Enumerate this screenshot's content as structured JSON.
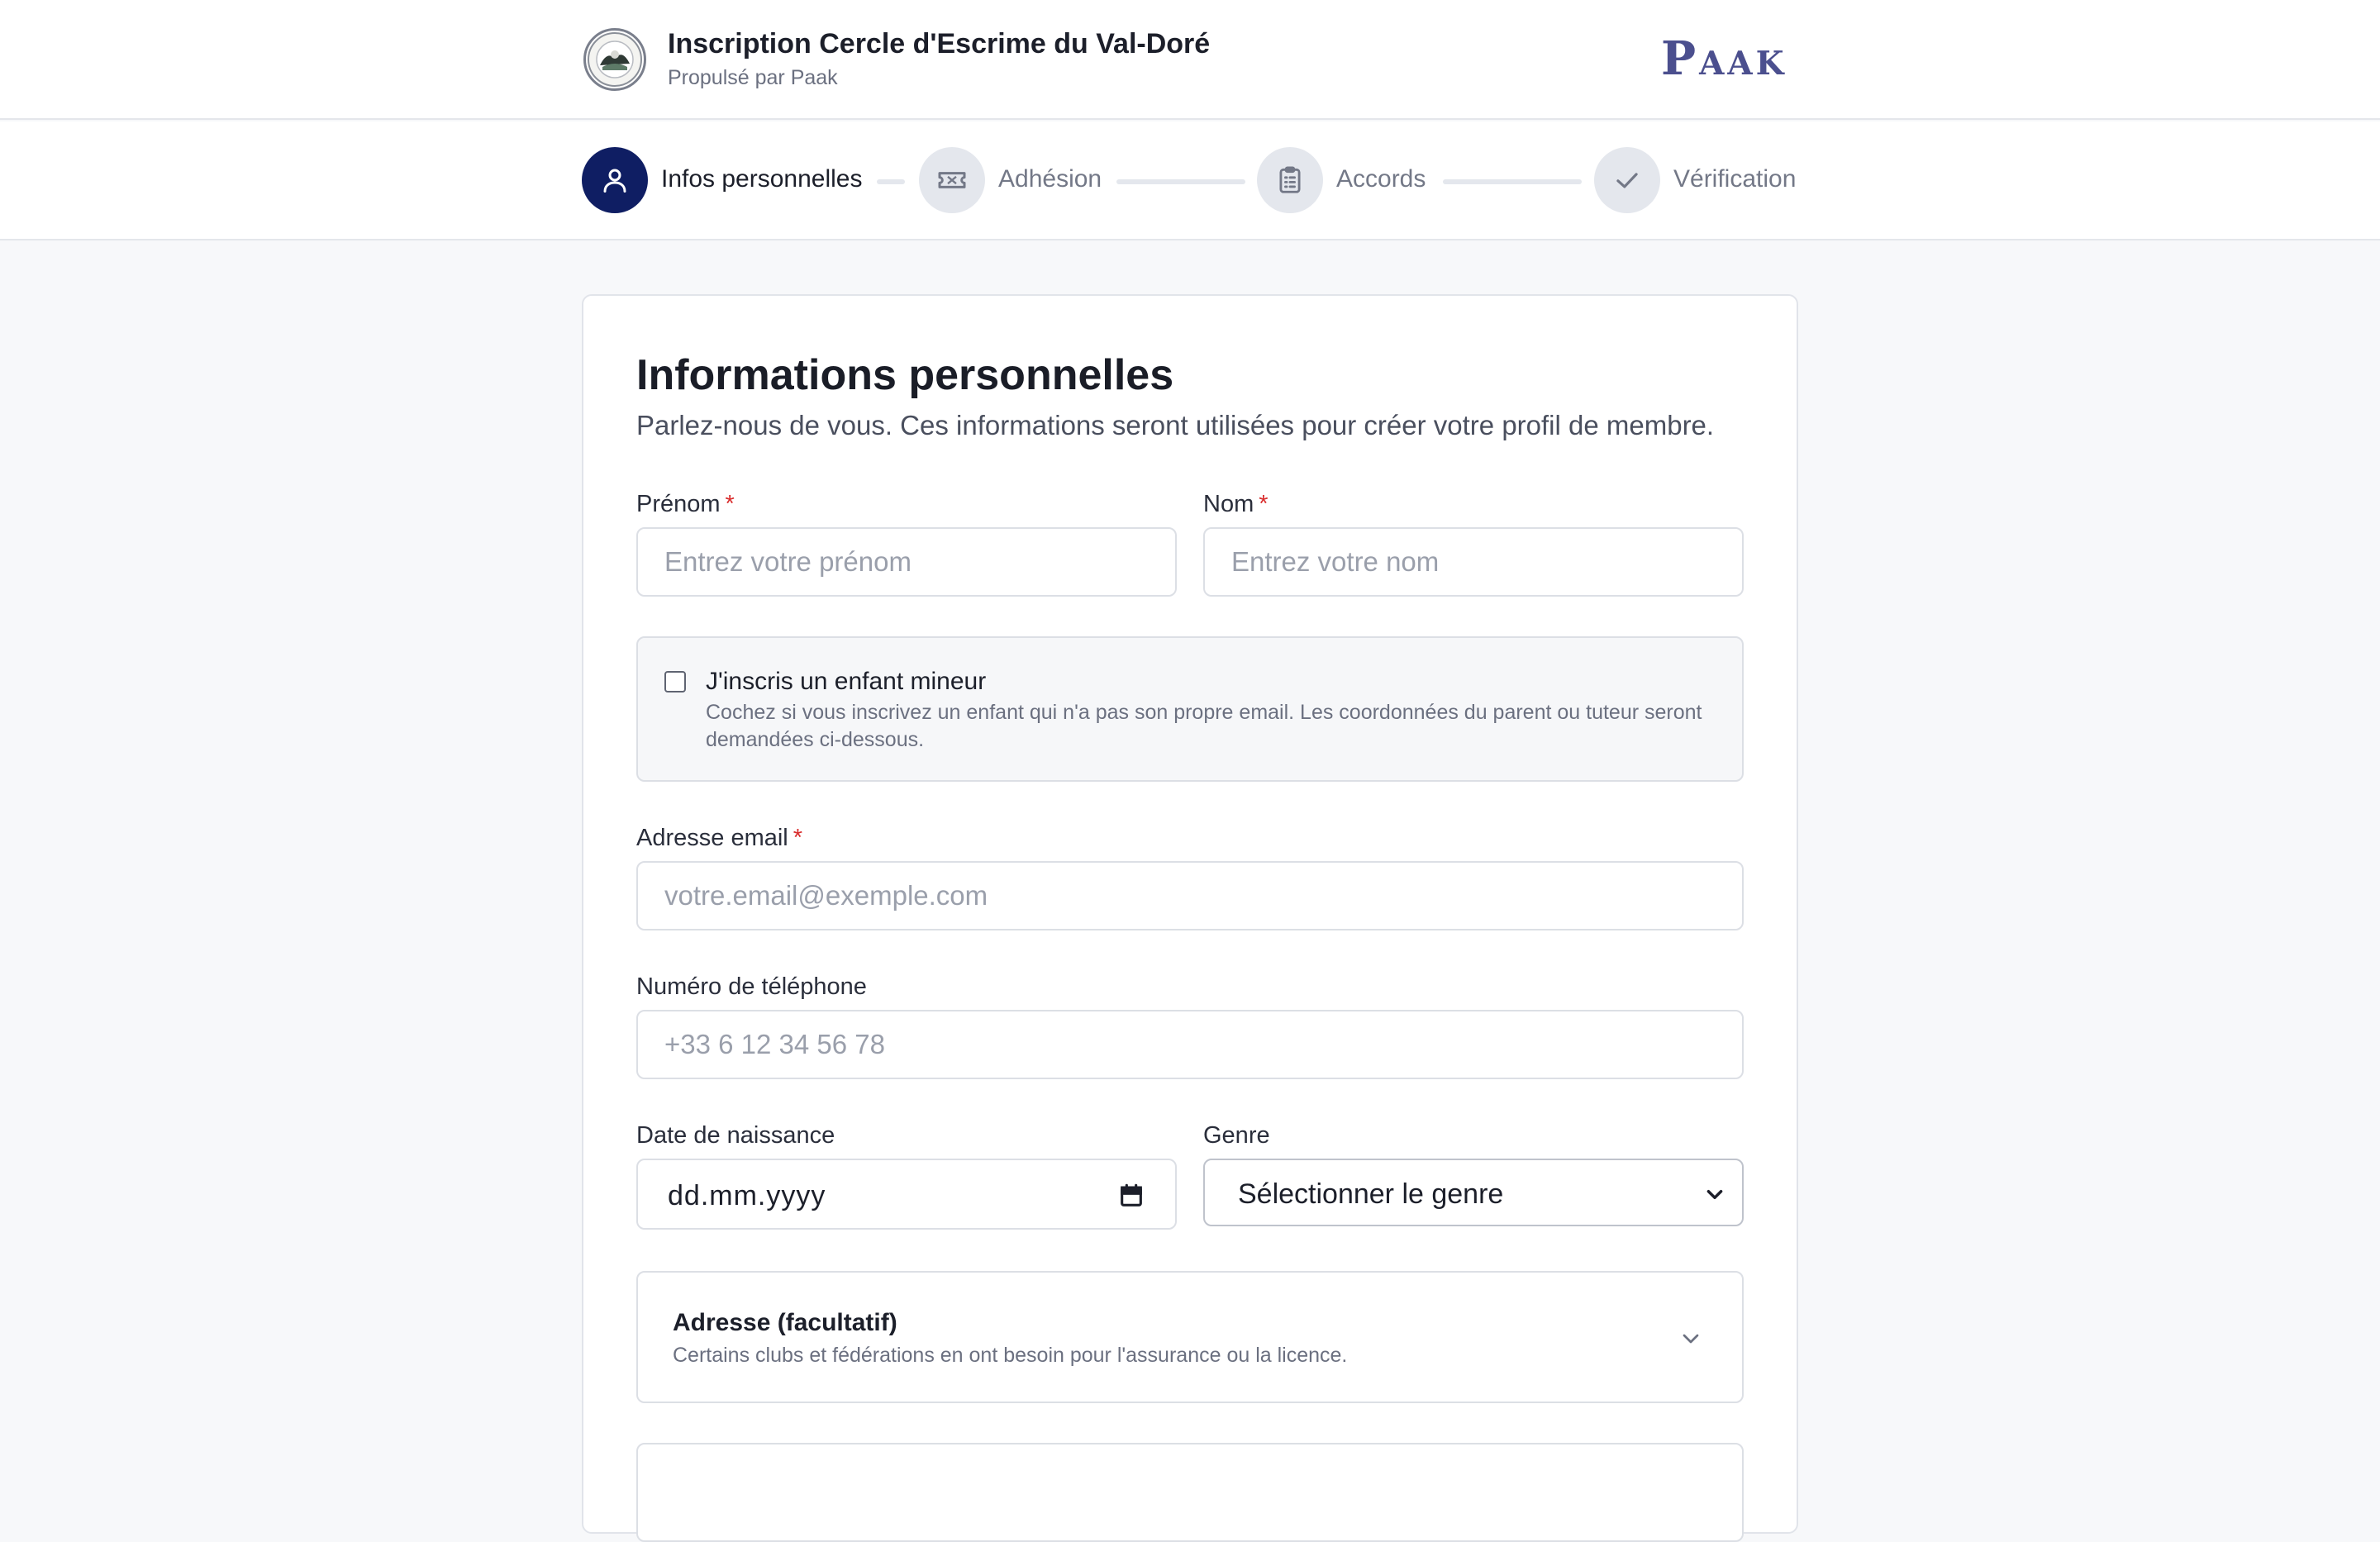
{
  "header": {
    "title": "Inscription Cercle d'Escrime du Val-Doré",
    "subtitle": "Propulsé par Paak",
    "brand": "Paak"
  },
  "stepper": {
    "steps": [
      {
        "label": "Infos personnelles",
        "icon": "user-icon",
        "active": true
      },
      {
        "label": "Adhésion",
        "icon": "ticket-icon",
        "active": false
      },
      {
        "label": "Accords",
        "icon": "clipboard-icon",
        "active": false
      },
      {
        "label": "Vérification",
        "icon": "check-icon",
        "active": false
      }
    ]
  },
  "form": {
    "title": "Informations personnelles",
    "description": "Parlez-nous de vous. Ces informations seront utilisées pour créer votre profil de membre.",
    "first_name": {
      "label": "Prénom",
      "required": "*",
      "placeholder": "Entrez votre prénom"
    },
    "last_name": {
      "label": "Nom",
      "required": "*",
      "placeholder": "Entrez votre nom"
    },
    "minor": {
      "label": "J'inscris un enfant mineur",
      "description": "Cochez si vous inscrivez un enfant qui n'a pas son propre email. Les coordonnées du parent ou tuteur seront demandées ci-dessous.",
      "checked": false
    },
    "email": {
      "label": "Adresse email",
      "required": "*",
      "placeholder": "votre.email@exemple.com"
    },
    "phone": {
      "label": "Numéro de téléphone",
      "placeholder": "+33 6 12 34 56 78"
    },
    "birthdate": {
      "label": "Date de naissance",
      "value": "dd.mm.yyyy"
    },
    "gender": {
      "label": "Genre",
      "selected": "Sélectionner le genre"
    },
    "address": {
      "title": "Adresse (facultatif)",
      "description": "Certains clubs et fédérations en ont besoin pour l'assurance ou la licence."
    }
  },
  "colors": {
    "accent": "#0f1e63",
    "required": "#d92d2d",
    "brand": "#4b4f8e"
  }
}
